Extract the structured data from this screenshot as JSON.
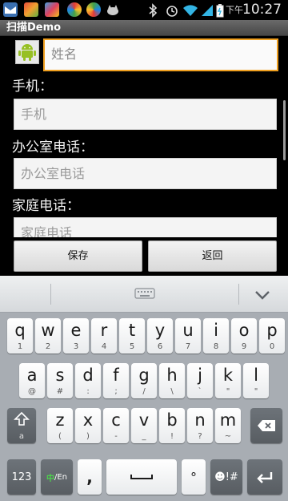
{
  "status_bar": {
    "ampm": "下午",
    "time": "10:27"
  },
  "app": {
    "title": "扫描Demo"
  },
  "form": {
    "name_placeholder": "姓名",
    "mobile_label": "手机：",
    "mobile_placeholder": "手机",
    "office_label": "办公室电话：",
    "office_placeholder": "办公室电话",
    "home_label": "家庭电话：",
    "home_placeholder": "家庭电话"
  },
  "buttons": {
    "save": "保存",
    "back": "返回"
  },
  "keyboard": {
    "row1": [
      {
        "main": "q",
        "sub": "1"
      },
      {
        "main": "w",
        "sub": "2"
      },
      {
        "main": "e",
        "sub": "3"
      },
      {
        "main": "r",
        "sub": "4"
      },
      {
        "main": "t",
        "sub": "5"
      },
      {
        "main": "y",
        "sub": "6"
      },
      {
        "main": "u",
        "sub": "7"
      },
      {
        "main": "i",
        "sub": "8"
      },
      {
        "main": "o",
        "sub": "9"
      },
      {
        "main": "p",
        "sub": "0"
      }
    ],
    "row2": [
      {
        "main": "a",
        "sub": "@"
      },
      {
        "main": "s",
        "sub": "#"
      },
      {
        "main": "d",
        "sub": ":"
      },
      {
        "main": "f",
        "sub": ";"
      },
      {
        "main": "g",
        "sub": "/"
      },
      {
        "main": "h",
        "sub": "\\"
      },
      {
        "main": "j",
        "sub": "`"
      },
      {
        "main": "k",
        "sub": "\""
      },
      {
        "main": "l",
        "sub": "\""
      }
    ],
    "row3": [
      {
        "main": "z",
        "sub": "("
      },
      {
        "main": "x",
        "sub": ")"
      },
      {
        "main": "c",
        "sub": "-"
      },
      {
        "main": "v",
        "sub": "_"
      },
      {
        "main": "b",
        "sub": "!"
      },
      {
        "main": "n",
        "sub": "?"
      },
      {
        "main": "m",
        "sub": "~"
      }
    ],
    "shift_sub": "a",
    "num_key": "123",
    "lang_key_cn": "中",
    "lang_key_en": "/En",
    "comma_key": ",",
    "period_key": "°",
    "emoji_key": "☻!#",
    "accent_color": "#1c8a1c"
  }
}
